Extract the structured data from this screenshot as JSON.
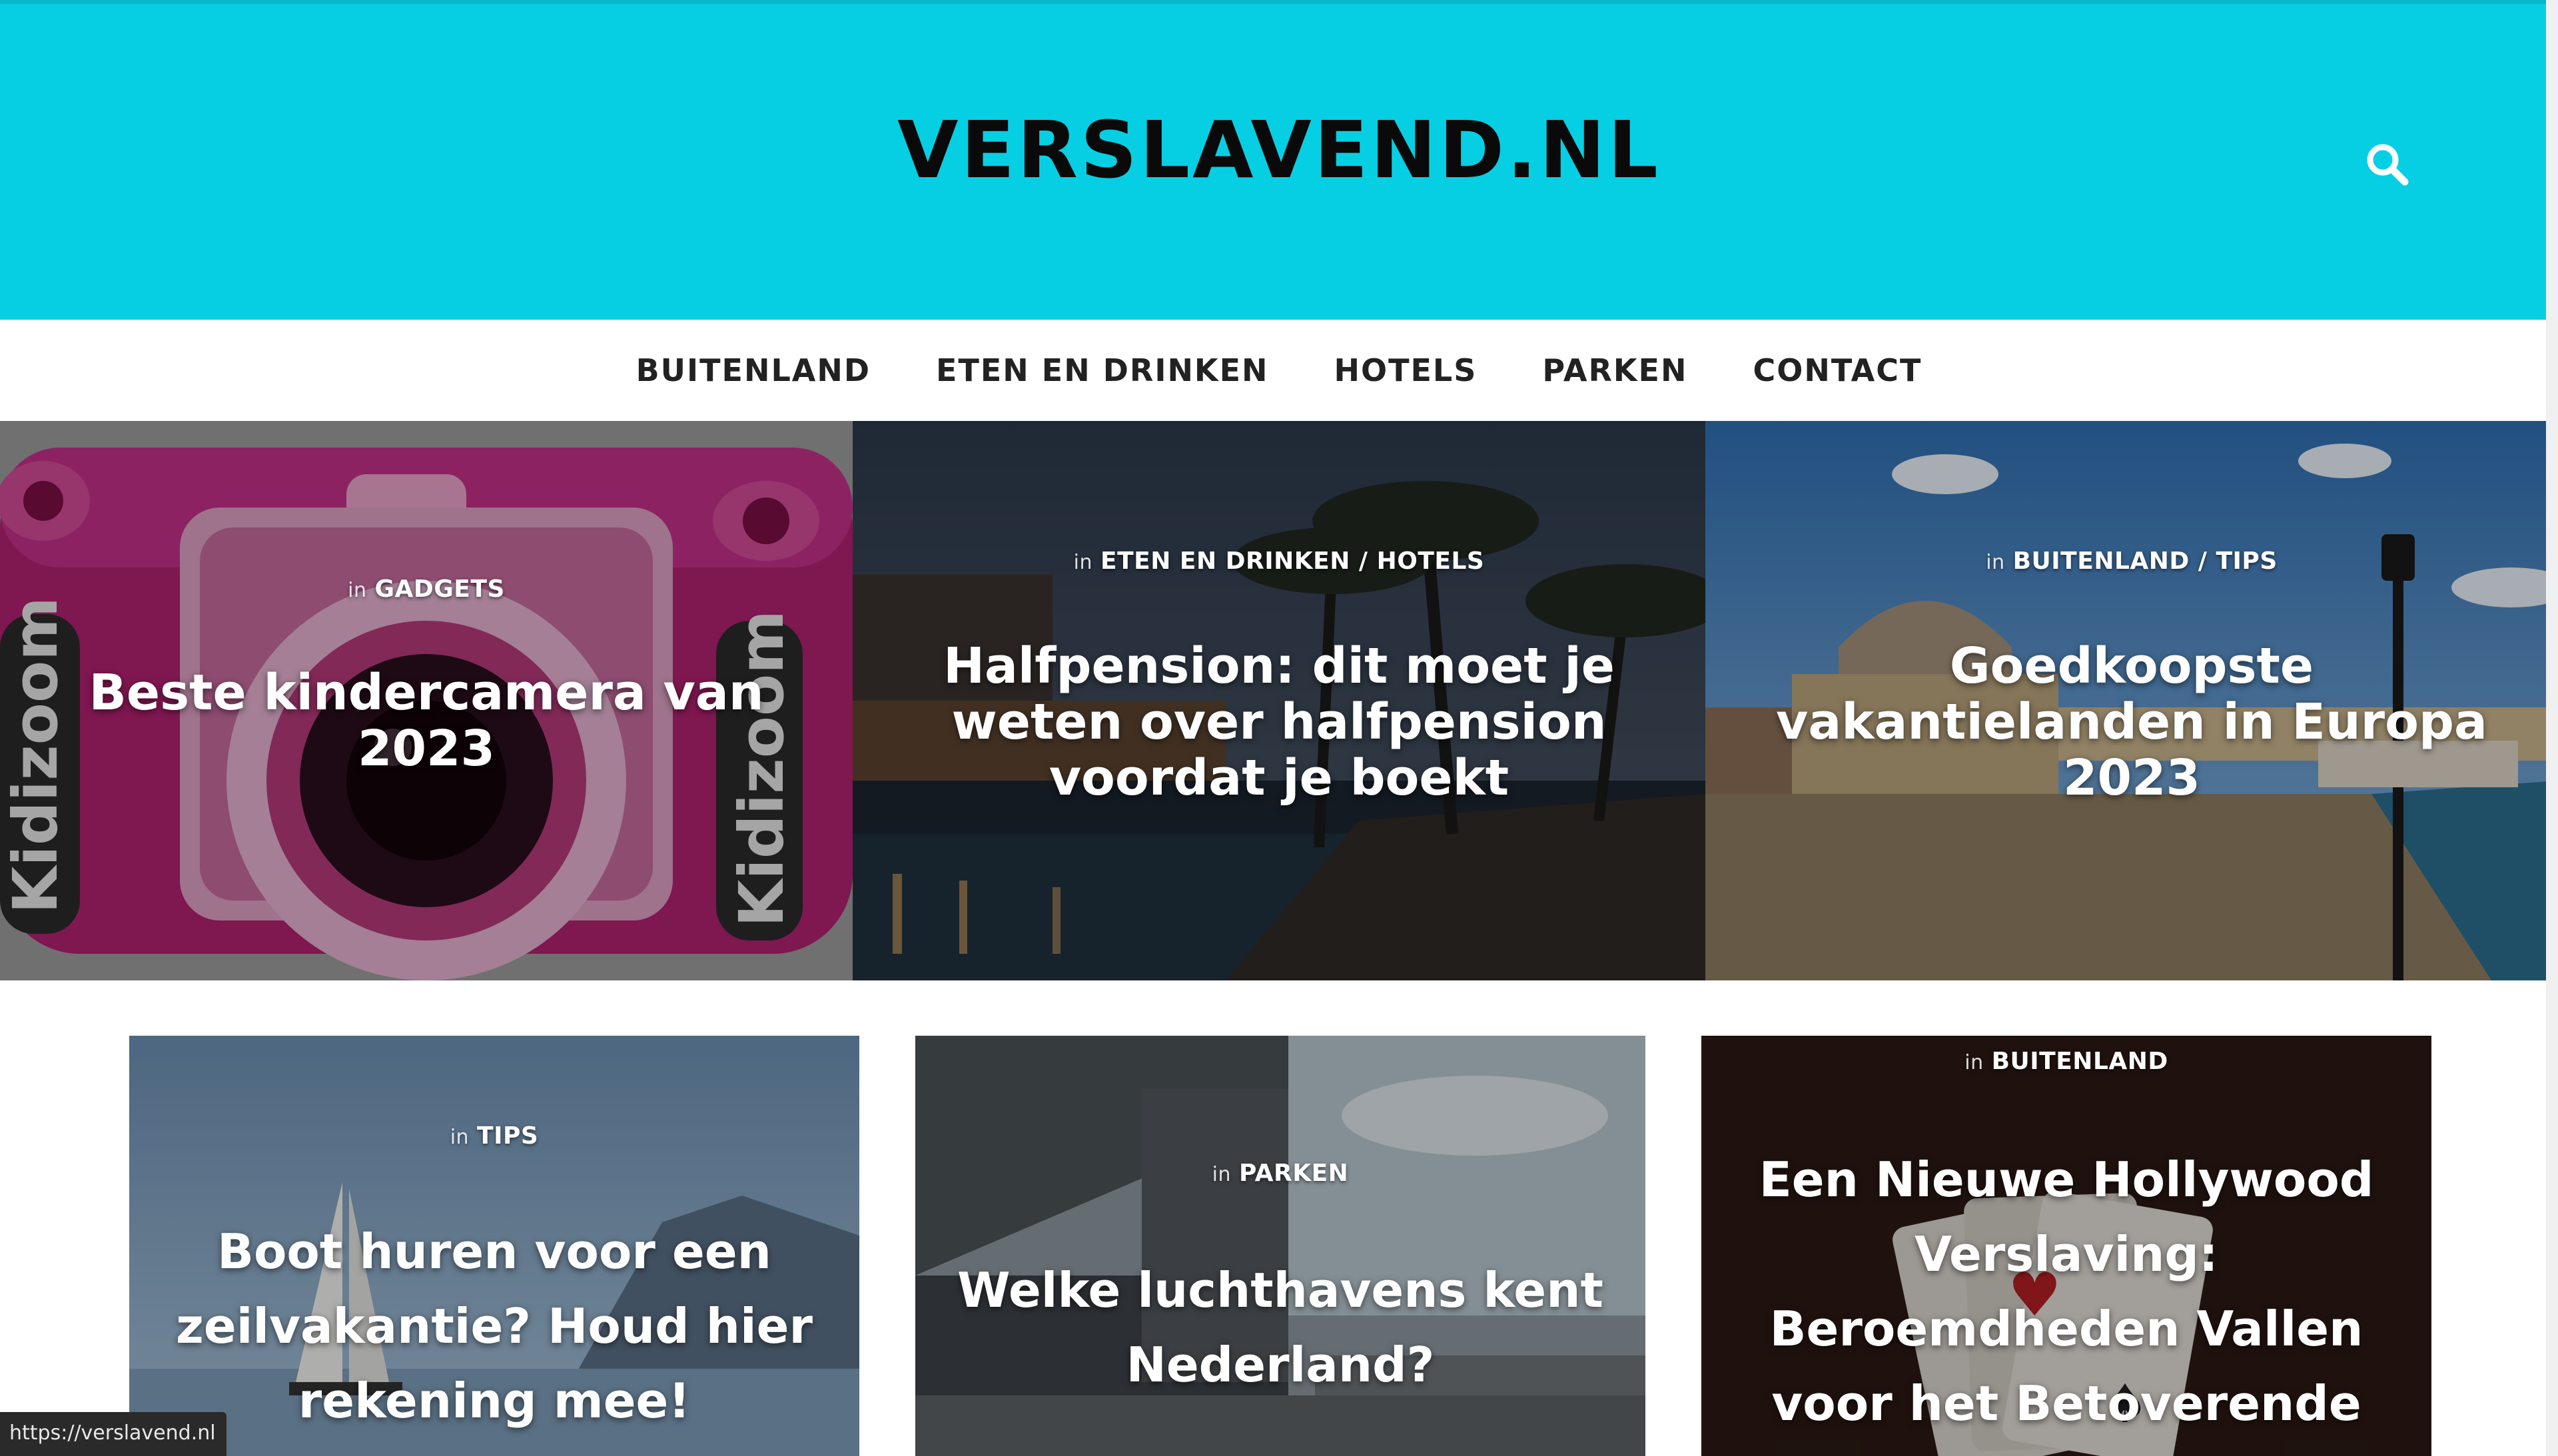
{
  "site": {
    "logo": "VERSLAVEND.NL",
    "search_icon": "search-icon",
    "header_color": "#06cfe3"
  },
  "nav": {
    "items": [
      {
        "label": "BUITENLAND"
      },
      {
        "label": "ETEN EN DRINKEN"
      },
      {
        "label": "HOTELS"
      },
      {
        "label": "PARKEN"
      },
      {
        "label": "CONTACT"
      }
    ]
  },
  "featured": [
    {
      "in": "in",
      "categories": "GADGETS",
      "title": "Beste kindercamera van 2023",
      "image": "pink-kids-camera"
    },
    {
      "in": "in",
      "categories": "ETEN EN DRINKEN / HOTELS",
      "title": "Halfpension: dit moet je weten over halfpension voordat je boekt",
      "image": "resort-pool-at-dusk"
    },
    {
      "in": "in",
      "categories": "BUITENLAND / TIPS",
      "title": "Goedkoopste vakantielanden in Europa 2023",
      "image": "mediterranean-harbor"
    }
  ],
  "grid": [
    {
      "in": "in",
      "categories": "TIPS",
      "title": "Boot huren voor een zeilvakantie? Houd hier rekening mee!",
      "image": "sailboat-lake"
    },
    {
      "in": "in",
      "categories": "PARKEN",
      "title": "Welke luchthavens kent Nederland?",
      "image": "airport-terminal"
    },
    {
      "in": "in",
      "categories": "BUITENLAND",
      "title": "Een Nieuwe Hollywood Verslaving: Beroemdheden Vallen voor het Betoverende",
      "image": "playing-cards"
    }
  ],
  "status_url": "https://verslavend.nl"
}
